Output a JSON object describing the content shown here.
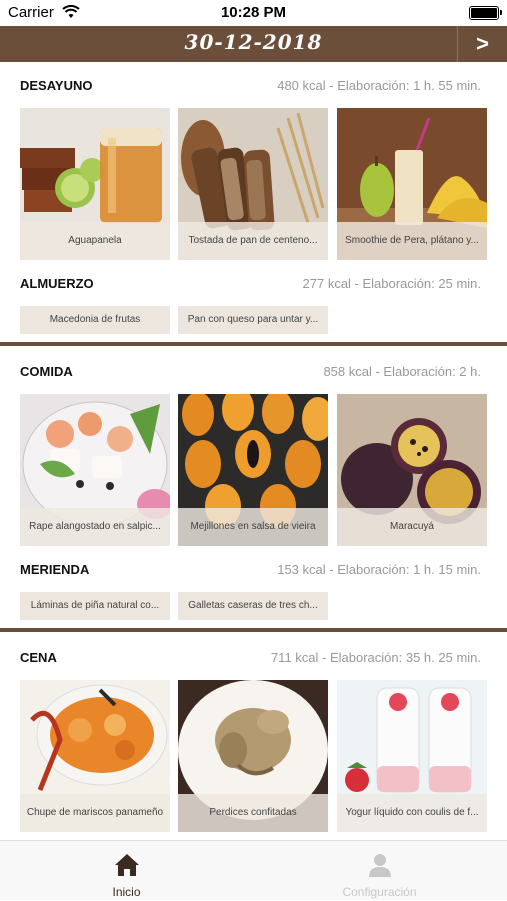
{
  "status_bar": {
    "carrier": "Carrier",
    "time": "10:28 PM"
  },
  "header": {
    "date": "30-12-2018",
    "next_symbol": ">"
  },
  "meals": {
    "desayuno": {
      "title": "DESAYUNO",
      "info": "480 kcal - Elaboración: 1 h. 55 min.",
      "items": [
        "Aguapanela",
        "Tostada de pan de centeno...",
        "Smoothie de Pera, plátano y..."
      ]
    },
    "almuerzo": {
      "title": "ALMUERZO",
      "info": "277 kcal - Elaboración: 25 min.",
      "items": [
        "Macedonia de frutas",
        "Pan con queso para untar y..."
      ]
    },
    "comida": {
      "title": "COMIDA",
      "info": "858 kcal - Elaboración: 2 h.",
      "items": [
        "Rape alangostado en salpic...",
        "Mejillones en salsa de vieira",
        "Maracuyá"
      ]
    },
    "merienda": {
      "title": "MERIENDA",
      "info": "153 kcal - Elaboración: 1 h. 15 min.",
      "items": [
        "Láminas de piña natural co...",
        "Galletas caseras de tres ch..."
      ]
    },
    "cena": {
      "title": "CENA",
      "info": "711 kcal - Elaboración: 35 h. 25 min.",
      "items": [
        "Chupe de mariscos panameño",
        "Perdices confitadas",
        "Yogur líquido con coulis de f..."
      ]
    }
  },
  "tabbar": {
    "home_label": "Inicio",
    "settings_label": "Configuración"
  },
  "colors": {
    "brand_brown": "#6b4f3b",
    "chip_bg": "#ede6de",
    "info_gray": "#999999",
    "inactive_tab": "#c8c8c8"
  },
  "icons": {
    "wifi": "wifi-icon",
    "battery": "battery-icon",
    "home": "home-icon",
    "user": "user-icon",
    "next": "chevron-right-icon"
  }
}
